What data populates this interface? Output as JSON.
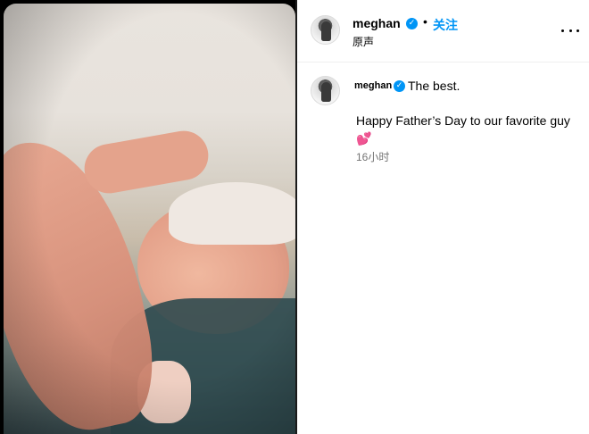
{
  "post": {
    "author": "meghan",
    "verified_icon": "verified-badge-icon",
    "separator": "•",
    "follow_label": "关注",
    "audio_label": "原声",
    "more_icon": "more-horizontal-icon"
  },
  "caption": {
    "author": "meghan",
    "line1": "The best.",
    "line2": "Happy Father’s Day to our favorite guy",
    "emoji": "💕",
    "timestamp": "16小时"
  },
  "colors": {
    "accent": "#0095f6",
    "muted_text": "#737373",
    "border": "#efefef"
  }
}
